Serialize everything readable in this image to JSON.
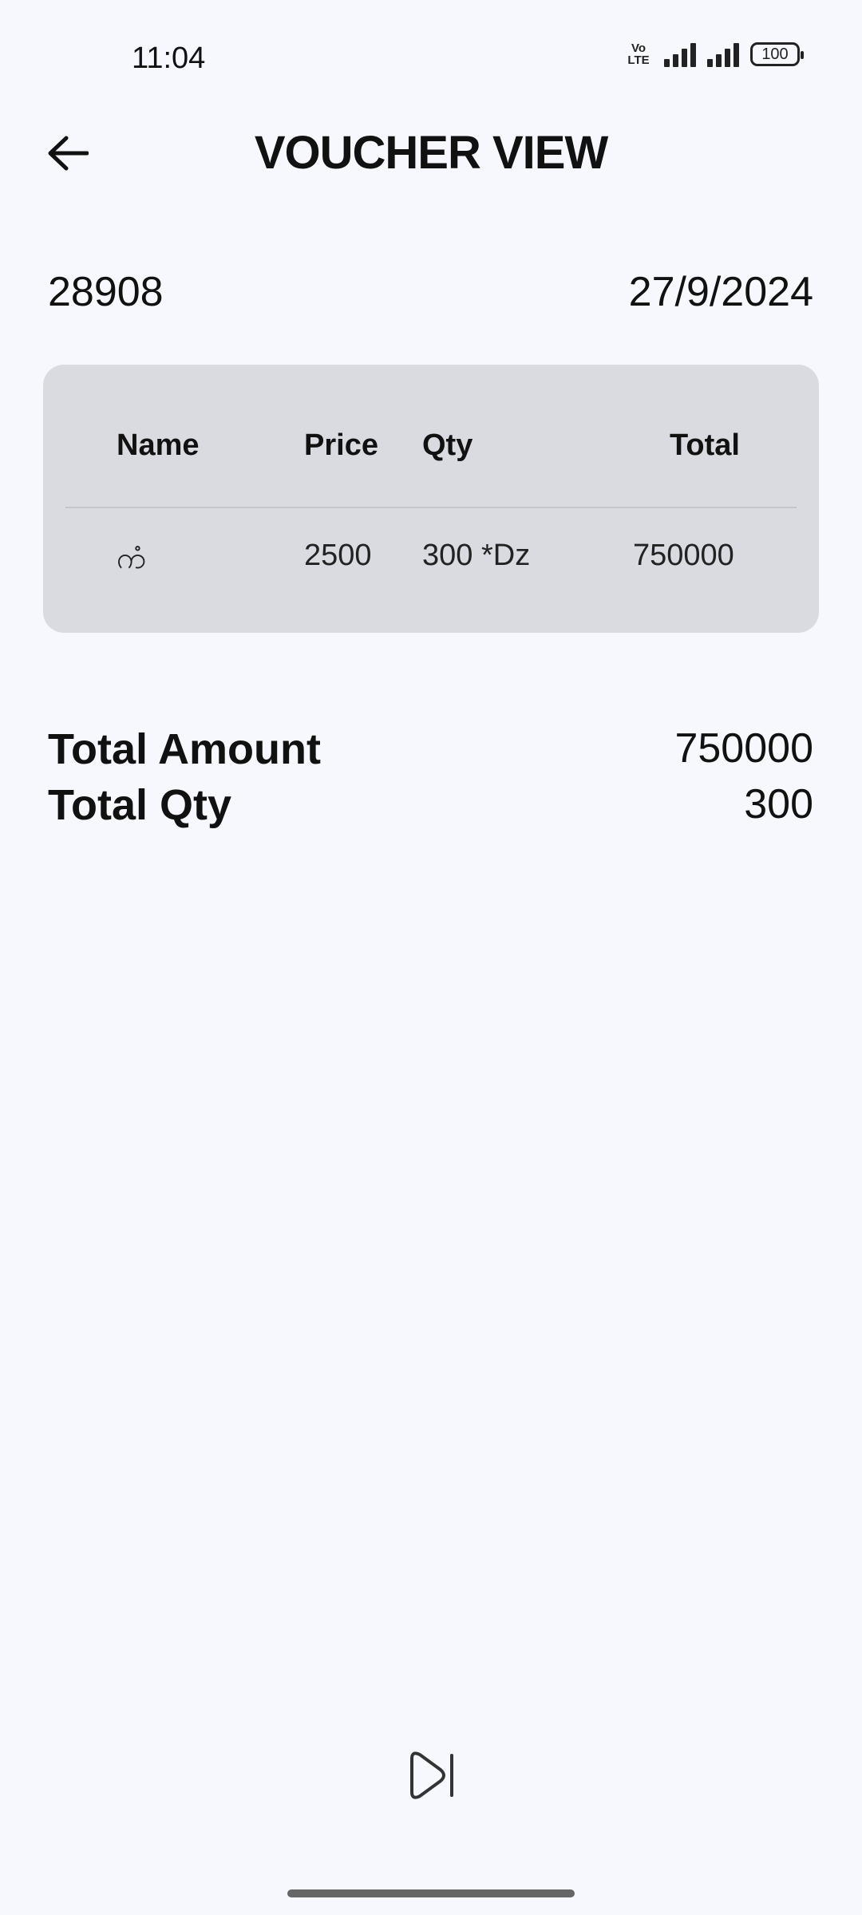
{
  "status_bar": {
    "time": "11:04",
    "volte_label": "Vo LTE",
    "battery": "100"
  },
  "header": {
    "title": "VOUCHER VIEW",
    "back_icon": "arrow-left-icon"
  },
  "voucher": {
    "number": "28908",
    "date": "27/9/2024"
  },
  "items_table": {
    "headers": [
      "Name",
      "Price",
      "Qty",
      "Total"
    ],
    "rows": [
      {
        "name": "ကံ",
        "price": "2500",
        "qty": "300 *Dz",
        "total": "750000"
      }
    ]
  },
  "summary": {
    "total_amount_label": "Total Amount",
    "total_amount_value": "750000",
    "total_qty_label": "Total Qty",
    "total_qty_value": "300"
  },
  "bottom": {
    "play_icon": "play-skip-icon"
  }
}
